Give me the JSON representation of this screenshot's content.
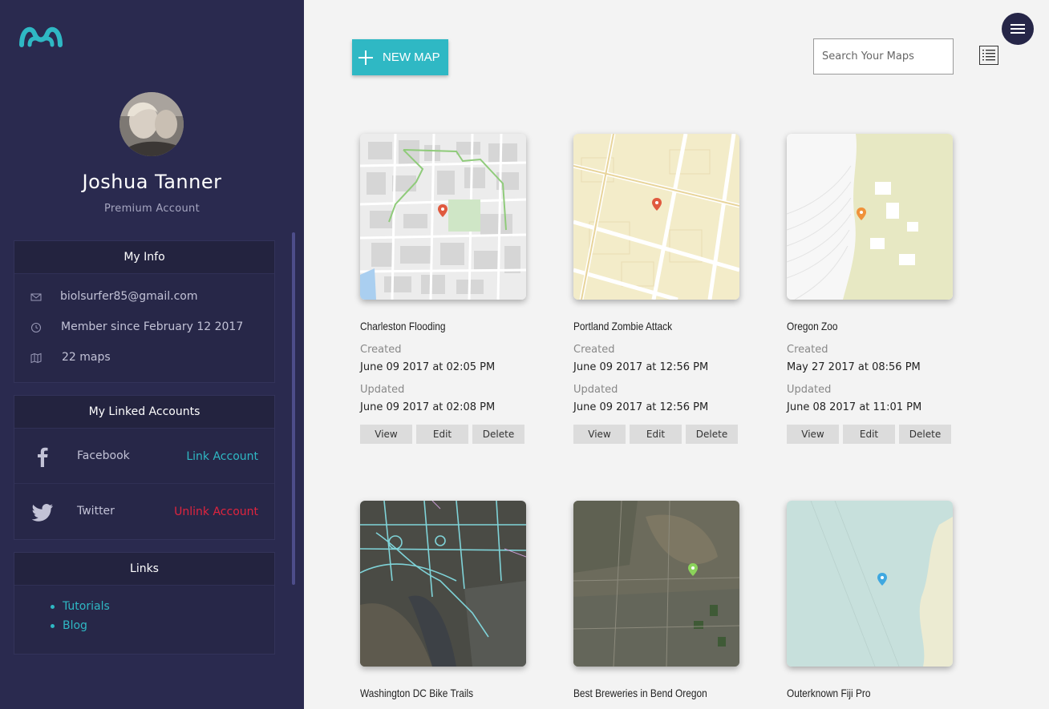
{
  "brand": {
    "accent": "#2fb8c4",
    "sidebar_bg": "#2a2a4f",
    "danger": "#e0243e"
  },
  "profile": {
    "name": "Joshua Tanner",
    "tier": "Premium Account"
  },
  "my_info": {
    "title": "My Info",
    "email": "biolsurfer85@gmail.com",
    "member_since": "Member since February 12 2017",
    "map_count": "22 maps"
  },
  "linked_accounts": {
    "title": "My Linked Accounts",
    "facebook": {
      "name": "Facebook",
      "action": "Link Account"
    },
    "twitter": {
      "name": "Twitter",
      "action": "Unlink Account"
    }
  },
  "links": {
    "title": "Links",
    "items": [
      "Tutorials",
      "Blog"
    ]
  },
  "toolbar": {
    "new_map_label": "NEW MAP",
    "search_placeholder": "Search Your Maps"
  },
  "maps": [
    {
      "title": "Charleston Flooding",
      "created_label": "Created",
      "created": "June 09 2017 at 02:05 PM",
      "updated_label": "Updated",
      "updated": "June 09 2017 at 02:08 PM",
      "view": "View",
      "edit": "Edit",
      "delete": "Delete"
    },
    {
      "title": "Portland Zombie Attack",
      "created_label": "Created",
      "created": "June 09 2017 at 12:56 PM",
      "updated_label": "Updated",
      "updated": "June 09 2017 at 12:56 PM",
      "view": "View",
      "edit": "Edit",
      "delete": "Delete"
    },
    {
      "title": "Oregon Zoo",
      "created_label": "Created",
      "created": "May 27 2017 at 08:56 PM",
      "updated_label": "Updated",
      "updated": "June 08 2017 at 11:01 PM",
      "view": "View",
      "edit": "Edit",
      "delete": "Delete"
    },
    {
      "title": "Washington DC Bike Trails"
    },
    {
      "title": "Best Breweries in Bend Oregon"
    },
    {
      "title": "Outerknown Fiji Pro"
    }
  ]
}
